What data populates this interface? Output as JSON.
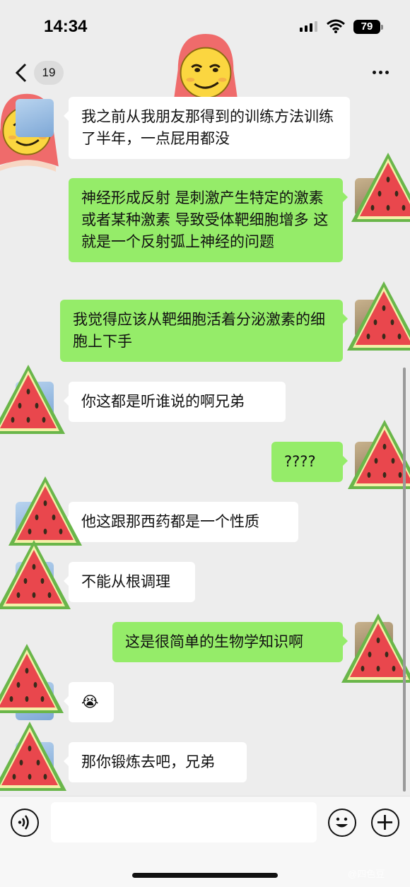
{
  "status": {
    "time": "14:34",
    "battery": "79"
  },
  "nav": {
    "unread_count": "19"
  },
  "messages": [
    {
      "side": "in",
      "text": "我之前从我朋友那得到的训练方法训练了半年，一点屁用都没"
    },
    {
      "side": "out",
      "text": "神经形成反射 是刺激产生特定的激素 或者某种激素 导致受体靶细胞增多 这就是一个反射弧上神经的问题"
    },
    {
      "side": "out",
      "text": "我觉得应该从靶细胞活着分泌激素的细胞上下手"
    },
    {
      "side": "in",
      "text": "你这都是听谁说的啊兄弟"
    },
    {
      "side": "out",
      "text": "????"
    },
    {
      "side": "in",
      "text": "他这跟那西药都是一个性质"
    },
    {
      "side": "in",
      "text": "不能从根调理"
    },
    {
      "side": "out",
      "text": "这是很简单的生物学知识啊"
    },
    {
      "side": "in",
      "text": "😭"
    },
    {
      "side": "in",
      "text": "那你锻炼去吧，兄弟"
    }
  ],
  "icons": {
    "back": "chevron-left-icon",
    "more": "more-dots-icon",
    "voice": "voice-icon",
    "emoji": "emoji-icon",
    "plus": "plus-icon"
  },
  "watermark": "@四色豆",
  "colors": {
    "outgoing_bubble": "#95ec69",
    "incoming_bubble": "#ffffff",
    "background": "#ededed"
  }
}
